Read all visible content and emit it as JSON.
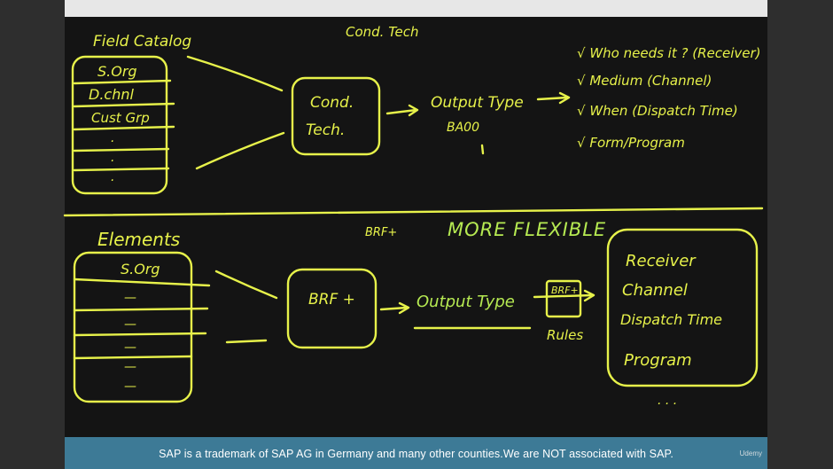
{
  "footer": {
    "notice": "SAP is a trademark of SAP AG in Germany and many other counties.We are NOT associated with SAP.",
    "logo_text": "Udemy"
  },
  "top_section": {
    "catalog_title": "Field Catalog",
    "catalog_fields": [
      "S.Org",
      "D.chnl",
      "Cust Grp",
      ".",
      ".",
      "."
    ],
    "cond_tech_header": "Cond. Tech",
    "box_line1": "Cond.",
    "box_line2": "Tech.",
    "output_type": "Output Type",
    "output_code": "BA00",
    "checklist": [
      "√ Who needs it ? (Receiver)",
      "√ Medium (Channel)",
      "√ When (Dispatch Time)",
      "√ Form/Program"
    ]
  },
  "bottom_section": {
    "brf_header": "BRF+",
    "flexible": "MORE FLEXIBLE",
    "elements_title": "Elements",
    "elements_fields": [
      "S.Org",
      "—",
      "—",
      "—",
      "—",
      "—"
    ],
    "box_label": "BRF +",
    "output_type": "Output Type",
    "small_box": "BRF+",
    "rules": "Rules",
    "results": [
      "Receiver",
      "Channel",
      "Dispatch Time",
      "Program"
    ],
    "dots": ". . ."
  },
  "colors": {
    "chalk_yellow": "#e7f24a",
    "chalk_green": "#b6ea52",
    "board": "#141414",
    "footer": "#3d7a96"
  }
}
